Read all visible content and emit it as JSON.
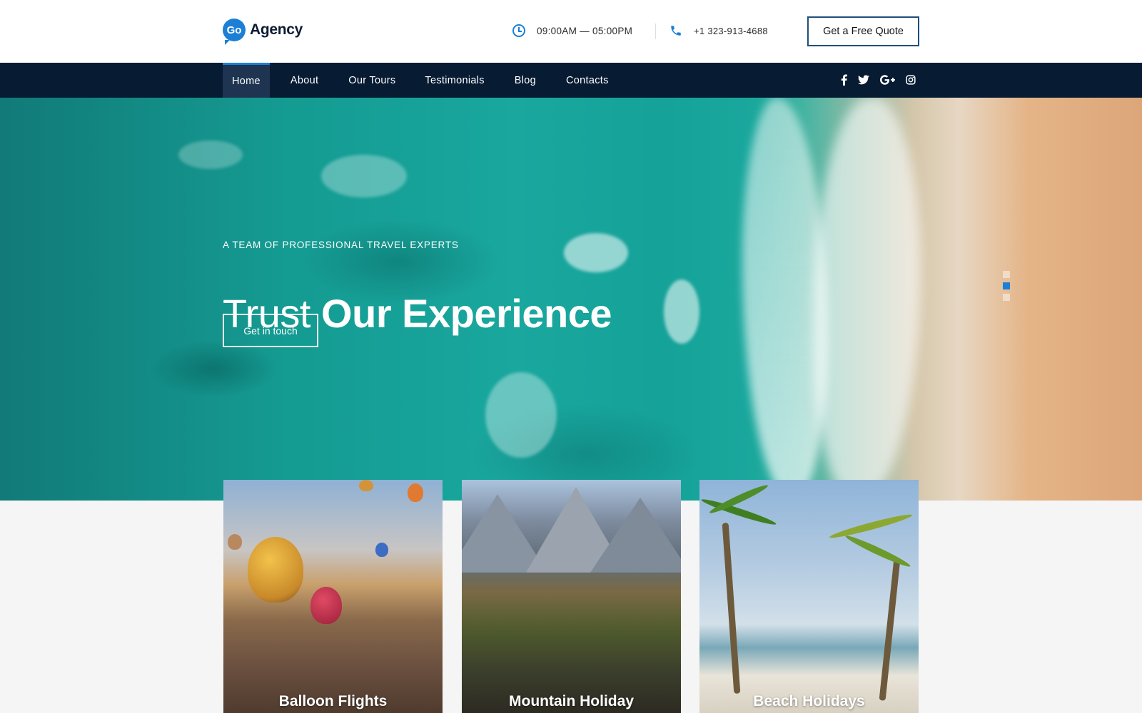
{
  "brand": {
    "badge": "Go",
    "name": "Agency"
  },
  "header": {
    "hours_icon": "clock-icon",
    "hours": "09:00AM — 05:00PM",
    "phone_icon": "phone-icon",
    "phone": "+1 323-913-4688",
    "quote_button": "Get a Free Quote"
  },
  "nav": {
    "items": [
      {
        "label": "Home",
        "active": true
      },
      {
        "label": "About",
        "active": false
      },
      {
        "label": "Our Tours",
        "active": false
      },
      {
        "label": "Testimonials",
        "active": false
      },
      {
        "label": "Blog",
        "active": false
      },
      {
        "label": "Contacts",
        "active": false
      }
    ],
    "social": [
      "facebook-icon",
      "twitter-icon",
      "google-plus-icon",
      "instagram-icon"
    ]
  },
  "hero": {
    "kicker": "A TEAM OF PROFESSIONAL TRAVEL EXPERTS",
    "title_light": "Trust",
    "title_bold": "Our Experience",
    "cta": "Get in touch",
    "slides": 3,
    "active_slide": 2
  },
  "cards": [
    {
      "title": "Balloon Flights"
    },
    {
      "title": "Mountain Holiday"
    },
    {
      "title": "Beach Holidays"
    }
  ],
  "colors": {
    "accent": "#1c7fd6",
    "nav_bg": "#071b33",
    "nav_active_bg": "#1e3450",
    "button_border": "#1f4f7a",
    "page_bg": "#f5f5f5"
  }
}
